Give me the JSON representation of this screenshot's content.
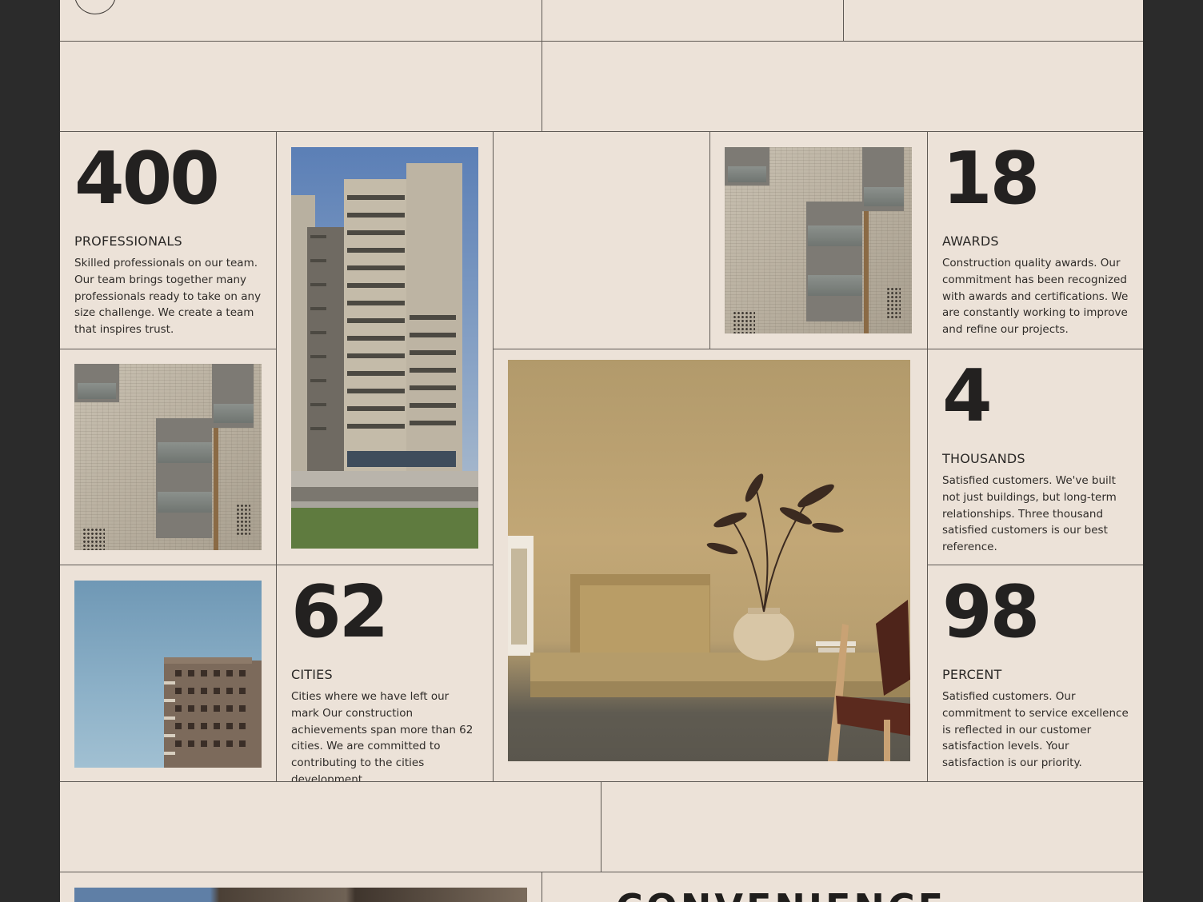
{
  "stats": [
    {
      "number": "400",
      "label": "PROFESSIONALS",
      "description": "Skilled professionals on our team. Our team brings together many professionals ready to take on any size challenge. We create a team that inspires trust."
    },
    {
      "number": "18",
      "label": "AWARDS",
      "description": "Construction quality awards. Our commitment has been recognized with awards and certifications. We are constantly working to improve and refine our projects."
    },
    {
      "number": "4",
      "label": "THOUSANDS",
      "description": "Satisfied customers. We've built not just buildings, but long-term relationships. Three thousand satisfied customers is our best reference."
    },
    {
      "number": "62",
      "label": "CITIES",
      "description": "Cities where we have left our mark Our construction achievements span more than 62 cities. We are committed to contributing to the cities development."
    },
    {
      "number": "98",
      "label": "PERCENT",
      "description": "Satisfied customers. Our commitment to service excellence is reflected in our customer satisfaction levels. Your satisfaction is our priority."
    }
  ],
  "next_section": {
    "title": "CONVENIENCE"
  },
  "colors": {
    "page_bg": "#ece2d8",
    "outer_bg": "#2b2b2b",
    "text": "#1e1e1e",
    "grid_line": "#5f5a55"
  }
}
